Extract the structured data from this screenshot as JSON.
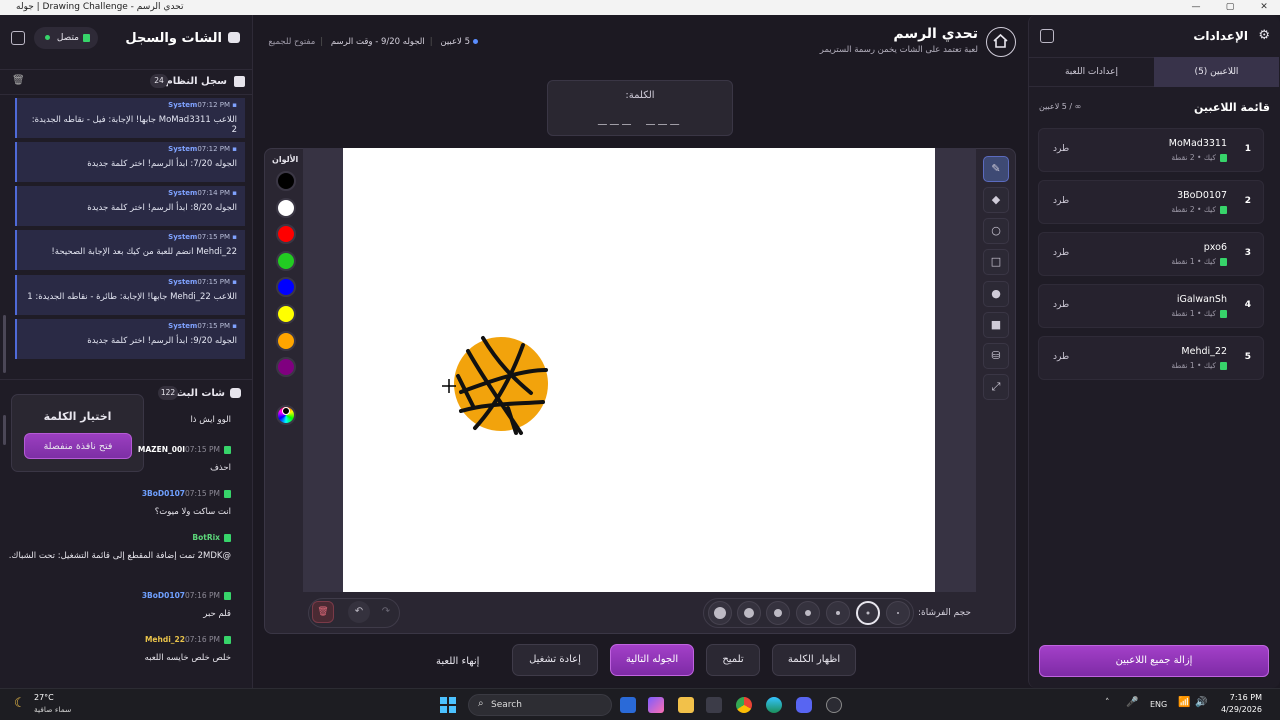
{
  "window": {
    "title": "جوله | Drawing Challenge - تحدي الرسم"
  },
  "left": {
    "title": "الشات والسجل",
    "status": "متصل",
    "syslog": {
      "title": "سجل النظام",
      "count": "24"
    },
    "system_messages": [
      {
        "sender": "System",
        "time": "07:12 PM",
        "text": "اللاعب MoMad3311 جابها! الإجابة: فيل - نقاطه الجديدة: 2"
      },
      {
        "sender": "System",
        "time": "07:12 PM",
        "text": "الجوله 7/20: ابدأ الرسم! اختر كلمة جديدة"
      },
      {
        "sender": "System",
        "time": "07:14 PM",
        "text": "الجوله 8/20: ابدأ الرسم! اختر كلمة جديدة"
      },
      {
        "sender": "System",
        "time": "07:15 PM",
        "text": "Mehdi_22 انضم للعبة من كيك بعد الإجابة الصحيحة!"
      },
      {
        "sender": "System",
        "time": "07:15 PM",
        "text": "اللاعب Mehdi_22 جابها! الإجابة: طائرة - نقاطه الجديدة: 1"
      },
      {
        "sender": "System",
        "time": "07:15 PM",
        "text": "الجوله 9/20: ابدأ الرسم! اختر كلمة جديدة"
      }
    ],
    "stream_chat": {
      "title": "شات البث",
      "count": "122"
    },
    "popup": {
      "title": "اختيار الكلمة",
      "button": "فتح نافذة منفصلة"
    },
    "chat_messages": [
      {
        "user": "",
        "time": "",
        "text": "الوو ايش ذا",
        "color": "#ffffff"
      },
      {
        "user": "MAZEN_00I",
        "time": "07:15 PM",
        "text": "احذف",
        "color": "#ffffff"
      },
      {
        "user": "3BoD0107",
        "time": "07:15 PM",
        "text": "انت ساكت ولا ميوت؟",
        "color": "#6fa0ff"
      },
      {
        "user": "BotRix",
        "time": "",
        "text": "@2MDK تمت إضافة المقطع إلى قائمة التشغيل: تحت الشباك.",
        "color": "#5cd67a"
      },
      {
        "user": "3BoD0107",
        "time": "07:16 PM",
        "text": "قلم حبر",
        "color": "#6fa0ff"
      },
      {
        "user": "Mehdi_22",
        "time": "07:16 PM",
        "text": "خلص خلص خايسه اللعبه",
        "color": "#e9c34a"
      }
    ]
  },
  "center": {
    "title": "تحدي الرسم",
    "subtitle": "لعبة تعتمد على الشات يخمن رسمة الستريمر",
    "info_players": "5 لاعبين",
    "info_round": "الجوله 9/20 - وقت الرسم",
    "info_open": "مفتوح للجميع",
    "word_label": "الكلمة:",
    "word_mask": "___ ___",
    "colors_label": "الألوان",
    "brush_label": "حجم الفرشاة:",
    "buttons": {
      "show_word": "اظهار الكلمة",
      "hint": "تلميح",
      "next_round": "الجوله التالية",
      "replay": "إعادة تشغيل",
      "end_game": "إنهاء اللعبة"
    },
    "colors": [
      "#000000",
      "#ffffff",
      "#ff0000",
      "#22cc22",
      "#0000ff",
      "#ffff00",
      "#ffa500",
      "#800080"
    ]
  },
  "right": {
    "title": "الإعدادات",
    "tab_players": "اللاعبين (5)",
    "tab_settings": "إعدادات اللعبة",
    "list_title": "قائمة اللاعبين",
    "list_count": "∞ / 5 لاعبين",
    "kick_label": "طرد",
    "players": [
      {
        "rank": "1",
        "name": "MoMad3311",
        "points": "كيك • 2 نقطة"
      },
      {
        "rank": "2",
        "name": "3BoD0107",
        "points": "كيك • 2 نقطة"
      },
      {
        "rank": "3",
        "name": "pxo6",
        "points": "كيك • 1 نقطة"
      },
      {
        "rank": "4",
        "name": "iGalwanSh",
        "points": "كيك • 1 نقطة"
      },
      {
        "rank": "5",
        "name": "Mehdi_22",
        "points": "كيك • 1 نقطة"
      }
    ],
    "remove_all": "إزالة جميع اللاعبين"
  },
  "taskbar": {
    "temp": "27°C",
    "weather": "سماء صافية",
    "search": "Search",
    "lang": "ENG",
    "time": "7:16 PM",
    "date": "4/29/2026"
  }
}
